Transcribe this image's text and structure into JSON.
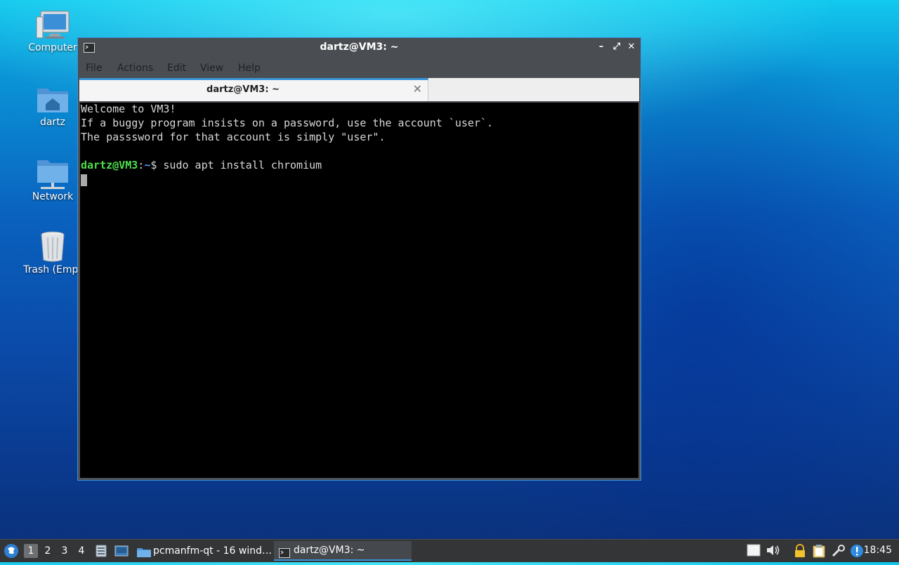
{
  "desktop": {
    "icons": [
      {
        "label": "Computer",
        "icon": "computer-icon"
      },
      {
        "label": "dartz",
        "icon": "home-folder-icon"
      },
      {
        "label": "Network",
        "icon": "network-folder-icon"
      },
      {
        "label": "Trash (Empt",
        "icon": "trash-icon"
      }
    ]
  },
  "window": {
    "title": "dartz@VM3: ~",
    "buttons": {
      "minimize": "–",
      "maximize": "⤢",
      "close": "✕"
    },
    "menu": [
      "File",
      "Actions",
      "Edit",
      "View",
      "Help"
    ],
    "tab": {
      "label": "dartz@VM3: ~",
      "close": "✕"
    },
    "terminal": {
      "lines": [
        "Welcome to VM3!",
        "If a buggy program insists on a password, use the account `user`.",
        "The passsword for that account is simply \"user\"."
      ],
      "prompt_user": "dartz@VM3",
      "prompt_sep": ":",
      "prompt_path": "~",
      "prompt_dollar": "$ ",
      "command": "sudo apt install chromium"
    }
  },
  "taskbar": {
    "workspaces": [
      "1",
      "2",
      "3",
      "4"
    ],
    "active_workspace": "1",
    "tasks": [
      {
        "label": "pcmanfm-qt - 16 wind…",
        "icon": "folder-icon"
      },
      {
        "label": "dartz@VM3: ~",
        "icon": "terminal-icon"
      }
    ],
    "tray_icons": [
      "notes-icon",
      "volume-icon",
      "lock-icon",
      "clipboard-icon",
      "network-tool-icon",
      "update-alert-icon"
    ],
    "clock": "18:45"
  },
  "colors": {
    "accent": "#3a93d8",
    "prompt_user": "#4ee04e",
    "prompt_path": "#5c8ff0"
  }
}
